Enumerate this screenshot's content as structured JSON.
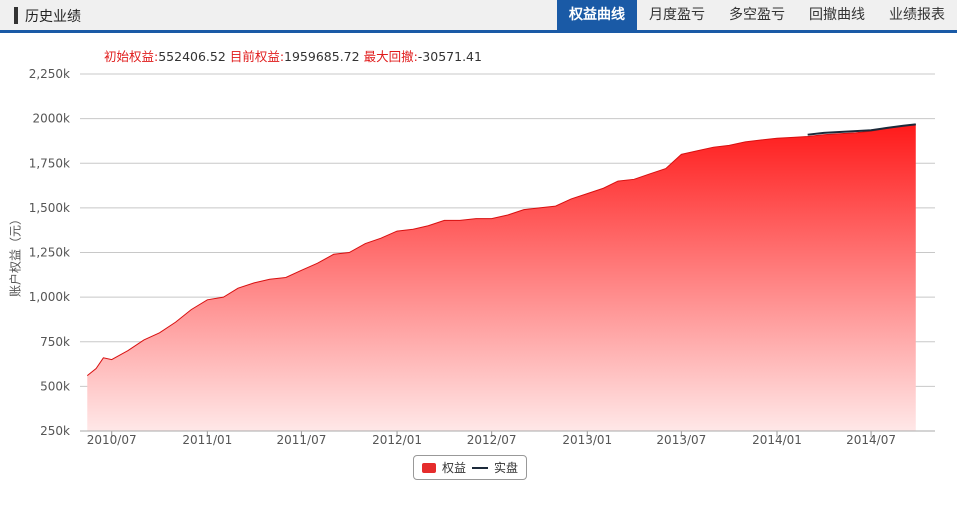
{
  "header": {
    "title": "历史业绩",
    "tabs": [
      {
        "label": "权益曲线",
        "active": true
      },
      {
        "label": "月度盈亏",
        "active": false
      },
      {
        "label": "多空盈亏",
        "active": false
      },
      {
        "label": "回撤曲线",
        "active": false
      },
      {
        "label": "业绩报表",
        "active": false
      }
    ]
  },
  "stats": {
    "initial_label": "初始权益:",
    "initial_value": "552406.52",
    "current_label": "目前权益:",
    "current_value": "1959685.72",
    "drawdown_label": "最大回撤:",
    "drawdown_value": "-30571.41"
  },
  "colors": {
    "accent": "#1a5aa6",
    "area_top": "#ff1a1a",
    "area_bottom": "#ffe8e8",
    "live_line": "#1c2a3a"
  },
  "chart_data": {
    "type": "area",
    "ylabel": "账户权益（元）",
    "ylim": [
      250000,
      2250000
    ],
    "yticks": [
      250000,
      500000,
      750000,
      1000000,
      1250000,
      1500000,
      1750000,
      2000000,
      2250000
    ],
    "ytick_labels": [
      "250k",
      "500k",
      "750k",
      "1,000k",
      "1,250k",
      "1,500k",
      "1,750k",
      "2000k",
      "2,250k"
    ],
    "xlim": [
      "2010-05-01",
      "2014-11-01"
    ],
    "xticks": [
      "2010-07-01",
      "2011-01-01",
      "2011-07-01",
      "2012-01-01",
      "2012-07-01",
      "2013-01-01",
      "2013-07-01",
      "2014-01-01",
      "2014-07-01"
    ],
    "xtick_labels": [
      "2010/07",
      "2011/01",
      "2011/07",
      "2012/01",
      "2012/07",
      "2013/01",
      "2013/07",
      "2014/01",
      "2014/07"
    ],
    "grid": true,
    "legend": "bottom-center",
    "series": [
      {
        "name": "权益",
        "kind": "area",
        "x": [
          "2010-05-15",
          "2010-06-01",
          "2010-06-15",
          "2010-07-01",
          "2010-08-01",
          "2010-09-01",
          "2010-10-01",
          "2010-11-01",
          "2010-12-01",
          "2011-01-01",
          "2011-02-01",
          "2011-03-01",
          "2011-04-01",
          "2011-05-01",
          "2011-06-01",
          "2011-07-01",
          "2011-08-01",
          "2011-09-01",
          "2011-10-01",
          "2011-11-01",
          "2011-12-01",
          "2012-01-01",
          "2012-02-01",
          "2012-03-01",
          "2012-04-01",
          "2012-05-01",
          "2012-06-01",
          "2012-07-01",
          "2012-08-01",
          "2012-09-01",
          "2012-10-01",
          "2012-11-01",
          "2012-12-01",
          "2013-01-01",
          "2013-02-01",
          "2013-03-01",
          "2013-04-01",
          "2013-05-01",
          "2013-06-01",
          "2013-07-01",
          "2013-08-01",
          "2013-09-01",
          "2013-10-01",
          "2013-11-01",
          "2013-12-01",
          "2014-01-01",
          "2014-02-01",
          "2014-03-01",
          "2014-04-01",
          "2014-05-01",
          "2014-06-01",
          "2014-07-01",
          "2014-08-01",
          "2014-09-01",
          "2014-09-25"
        ],
        "values": [
          560000,
          600000,
          660000,
          650000,
          700000,
          760000,
          800000,
          860000,
          930000,
          985000,
          1000000,
          1050000,
          1080000,
          1100000,
          1110000,
          1150000,
          1190000,
          1240000,
          1250000,
          1300000,
          1330000,
          1370000,
          1380000,
          1400000,
          1430000,
          1430000,
          1440000,
          1440000,
          1460000,
          1490000,
          1500000,
          1510000,
          1550000,
          1580000,
          1610000,
          1650000,
          1660000,
          1690000,
          1720000,
          1800000,
          1820000,
          1840000,
          1850000,
          1870000,
          1880000,
          1890000,
          1895000,
          1900000,
          1910000,
          1915000,
          1920000,
          1930000,
          1945000,
          1960000,
          1968000
        ]
      },
      {
        "name": "实盘",
        "kind": "line",
        "x": [
          "2014-03-01",
          "2014-04-01",
          "2014-05-01",
          "2014-06-01",
          "2014-07-01",
          "2014-08-01",
          "2014-09-01",
          "2014-09-25"
        ],
        "values": [
          1910000,
          1920000,
          1925000,
          1930000,
          1935000,
          1948000,
          1960000,
          1968000
        ]
      }
    ]
  },
  "legend": {
    "area_label": "权益",
    "line_label": "实盘"
  }
}
